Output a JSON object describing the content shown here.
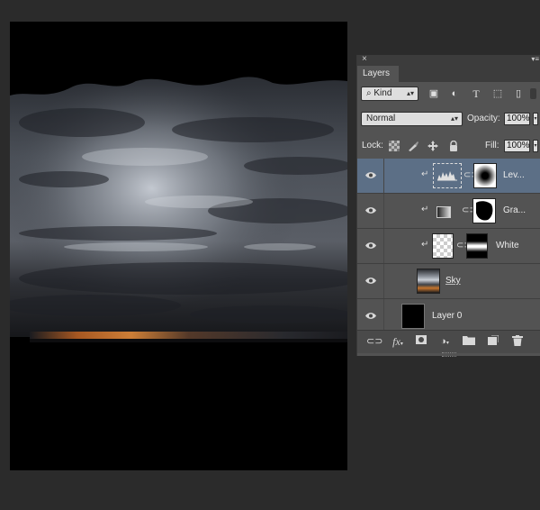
{
  "panel": {
    "close_glyph": "×",
    "menu_glyph": "▾≡",
    "tab_label": "Layers",
    "filter": {
      "label": "Kind",
      "icons": [
        "image-filter-icon",
        "adjustment-filter-icon",
        "type-filter-icon",
        "shape-filter-icon",
        "smart-object-filter-icon"
      ]
    },
    "blend_mode": "Normal",
    "opacity_label": "Opacity:",
    "opacity_value": "100%",
    "lock_label": "Lock:",
    "fill_label": "Fill:",
    "fill_value": "100%",
    "layers": [
      {
        "name": "Lev...",
        "type": "levels-adjustment",
        "selected": true,
        "clipped": true,
        "mask": "radial-white-center"
      },
      {
        "name": "Gra...",
        "type": "gradient-map-adjustment",
        "selected": false,
        "clipped": true,
        "mask": "white-blob"
      },
      {
        "name": "White",
        "type": "transparent-layer",
        "selected": false,
        "clipped": true,
        "mask": "horizontal-band"
      },
      {
        "name": "Sky",
        "type": "smart-object",
        "selected": false,
        "clipped": false,
        "mask": null
      },
      {
        "name": "Layer 0",
        "type": "black-fill",
        "selected": false,
        "clipped": false,
        "mask": null
      }
    ],
    "footer_icons": [
      "link-layers-icon",
      "fx-icon",
      "add-mask-icon",
      "new-adjustment-icon",
      "new-group-icon",
      "new-layer-icon",
      "delete-layer-icon"
    ],
    "fx_label": "fx"
  },
  "colors": {
    "app_background": "#2b2b2b",
    "panel_background": "#535353",
    "selected_row": "#5c6f86"
  }
}
